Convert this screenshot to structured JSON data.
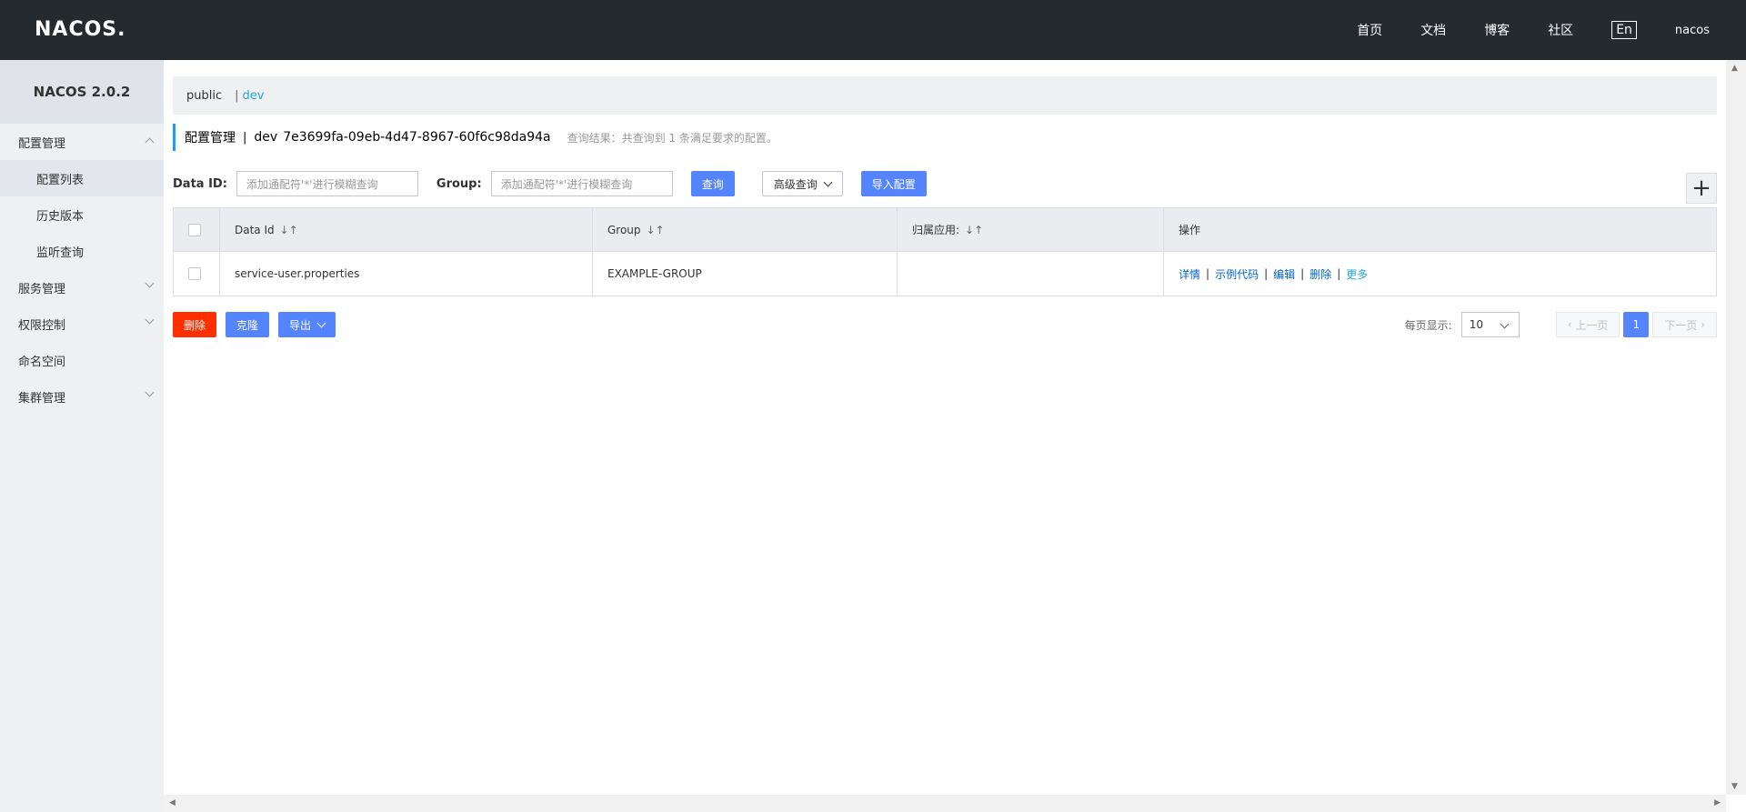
{
  "topbar": {
    "logo": "NACOS.",
    "nav": [
      "首页",
      "文档",
      "博客",
      "社区"
    ],
    "lang": "En",
    "user": "nacos"
  },
  "sidebar": {
    "title": "NACOS 2.0.2",
    "items": [
      {
        "label": "配置管理",
        "expanded": true
      },
      {
        "label": "配置列表",
        "sub": true,
        "active": true
      },
      {
        "label": "历史版本",
        "sub": true
      },
      {
        "label": "监听查询",
        "sub": true
      },
      {
        "label": "服务管理"
      },
      {
        "label": "权限控制"
      },
      {
        "label": "命名空间"
      },
      {
        "label": "集群管理"
      }
    ]
  },
  "namespace": {
    "public": "public",
    "separator": "|",
    "dev": "dev"
  },
  "title": {
    "main": "配置管理",
    "separator": "|",
    "namespace": "dev",
    "namespace_id": "7e3699fa-09eb-4d47-8967-60f6c98da94a",
    "result": "查询结果：共查询到 1 条满足要求的配置。"
  },
  "search": {
    "data_id_label": "Data ID:",
    "data_id_placeholder": "添加通配符'*'进行模糊查询",
    "group_label": "Group:",
    "group_placeholder": "添加通配符'*'进行模糊查询",
    "query_button": "查询",
    "advanced_button": "高级查询",
    "import_button": "导入配置",
    "add_button": "+"
  },
  "table": {
    "headers": [
      "Data Id",
      "Group",
      "归属应用:",
      "操作"
    ],
    "sort_glyph": "↓↑",
    "rows": [
      {
        "data_id": "service-user.properties",
        "group": "EXAMPLE-GROUP",
        "app": "",
        "ops": [
          "详情",
          "示例代码",
          "编辑",
          "删除"
        ],
        "more": "更多"
      }
    ],
    "op_separator": "|"
  },
  "bottom": {
    "delete_button": "删除",
    "clone_button": "克隆",
    "export_button": "导出",
    "page_size_label": "每页显示:",
    "page_size": "10",
    "prev": "上一页",
    "page": "1",
    "next": "下一页"
  }
}
